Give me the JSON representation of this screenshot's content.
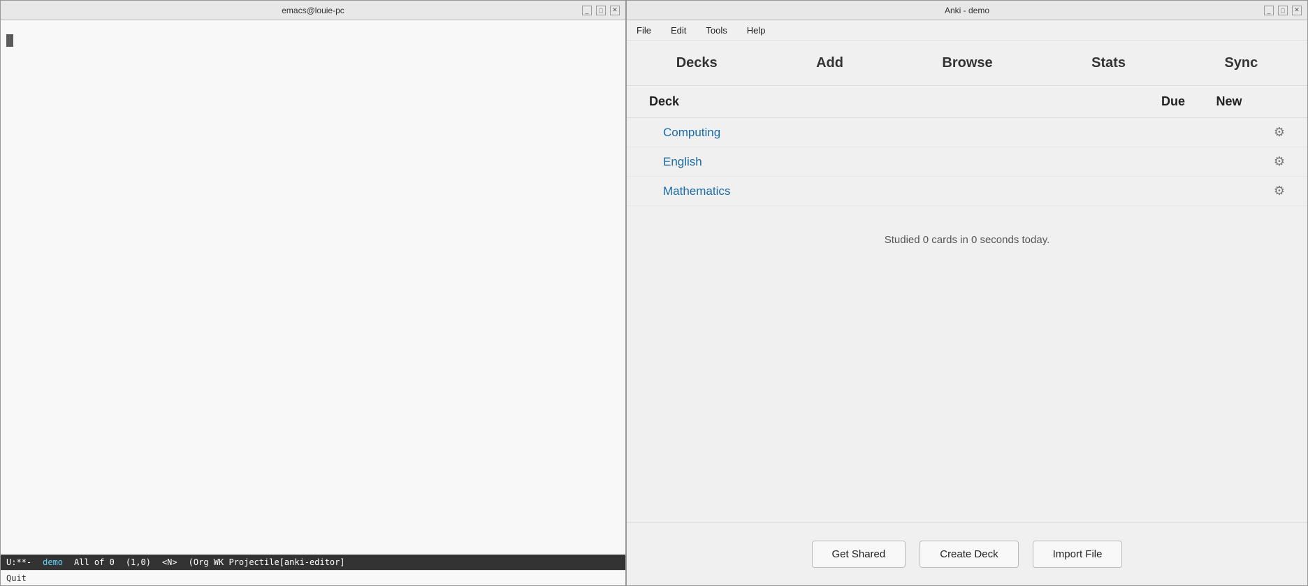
{
  "emacs": {
    "title": "emacs@louie-pc",
    "titlebar_buttons": [
      "_",
      "□",
      "✕"
    ],
    "statusbar": {
      "mode": "U:**-",
      "buffer": "demo",
      "position": "All of 0",
      "cursor": "(1,0)",
      "mode_label": "<N>",
      "minor_modes": "(Org WK Projectile[anki-editor]"
    },
    "bottombar": "Quit"
  },
  "anki": {
    "title": "Anki - demo",
    "titlebar_buttons": [
      "_",
      "□",
      "✕"
    ],
    "menu": {
      "file": "File",
      "edit": "Edit",
      "tools": "Tools",
      "help": "Help"
    },
    "navbar": {
      "decks": "Decks",
      "add": "Add",
      "browse": "Browse",
      "stats": "Stats",
      "sync": "Sync"
    },
    "deck_table": {
      "col_deck": "Deck",
      "col_due": "Due",
      "col_new": "New"
    },
    "decks": [
      {
        "name": "Computing",
        "due": "",
        "new_count": ""
      },
      {
        "name": "English",
        "due": "",
        "new_count": ""
      },
      {
        "name": "Mathematics",
        "due": "",
        "new_count": ""
      }
    ],
    "studied_text": "Studied 0 cards in 0 seconds today.",
    "footer": {
      "get_shared": "Get Shared",
      "create_deck": "Create Deck",
      "import_file": "Import File"
    }
  }
}
